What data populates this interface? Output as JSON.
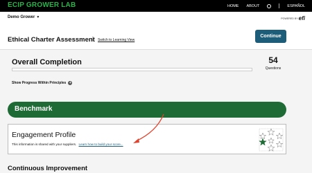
{
  "topbar": {
    "brand": "ECIP GROWER LAB",
    "nav": [
      "HOME",
      "ABOUT"
    ],
    "language": "ESPAÑOL"
  },
  "subbar": {
    "grower": "Demo Grower",
    "powered_by": "POWERED BY",
    "logo": "efi"
  },
  "header": {
    "title": "Ethical Charter Assessment",
    "switch_link": "Switch to Learning View",
    "continue_label": "Continue"
  },
  "completion": {
    "title": "Overall Completion",
    "progress_percent": 0,
    "count": "54",
    "count_label": "Questions",
    "show_progress": "Show Progress Within Principles"
  },
  "benchmark": {
    "label": "Benchmark"
  },
  "engagement": {
    "title": "Engagement Profile",
    "text": "This information is shared with your suppliers.",
    "link": "Learn how to build your score..."
  },
  "continuous": {
    "title": "Continuous Improvement"
  },
  "colors": {
    "brand": "#29b24a",
    "accent": "#1e5d7a",
    "benchmark": "#1f6b35",
    "arrow": "#e0442e"
  },
  "icons": {
    "user": "user-circle-icon",
    "plus": "plus-circle-icon",
    "stars": "star-wreath-icon",
    "caret": "caret-down-icon"
  }
}
